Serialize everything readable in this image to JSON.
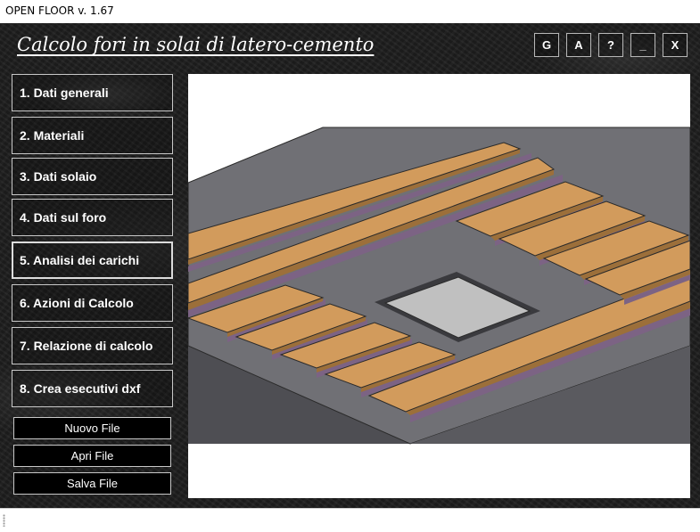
{
  "window": {
    "title": "OPEN FLOOR v. 1.67"
  },
  "header": {
    "title": "Calcolo fori in solai di latero-cemento",
    "buttons": [
      {
        "label": "G"
      },
      {
        "label": "A"
      },
      {
        "label": "?"
      },
      {
        "label": "_"
      },
      {
        "label": "X"
      }
    ]
  },
  "sidebar": {
    "items": [
      {
        "label": "1. Dati generali"
      },
      {
        "label": "2. Materiali"
      },
      {
        "label": "3. Dati solaio"
      },
      {
        "label": "4. Dati sul foro"
      },
      {
        "label": "5. Analisi dei carichi",
        "active": true
      },
      {
        "label": "6. Azioni di Calcolo"
      },
      {
        "label": "7. Relazione di calcolo"
      },
      {
        "label": "8. Crea esecutivi dxf"
      }
    ],
    "file_buttons": [
      {
        "label": "Nuovo File"
      },
      {
        "label": "Apri File"
      },
      {
        "label": "Salva File"
      }
    ]
  },
  "colors": {
    "slab_top": "#707075",
    "slab_side": "#4e4e53",
    "slab_front": "#5a5a5f",
    "joist": "#d29b5c",
    "joist_side": "#9c6f3a",
    "joist_shadow": "#7c6384",
    "hole": "#c0c0c0"
  }
}
